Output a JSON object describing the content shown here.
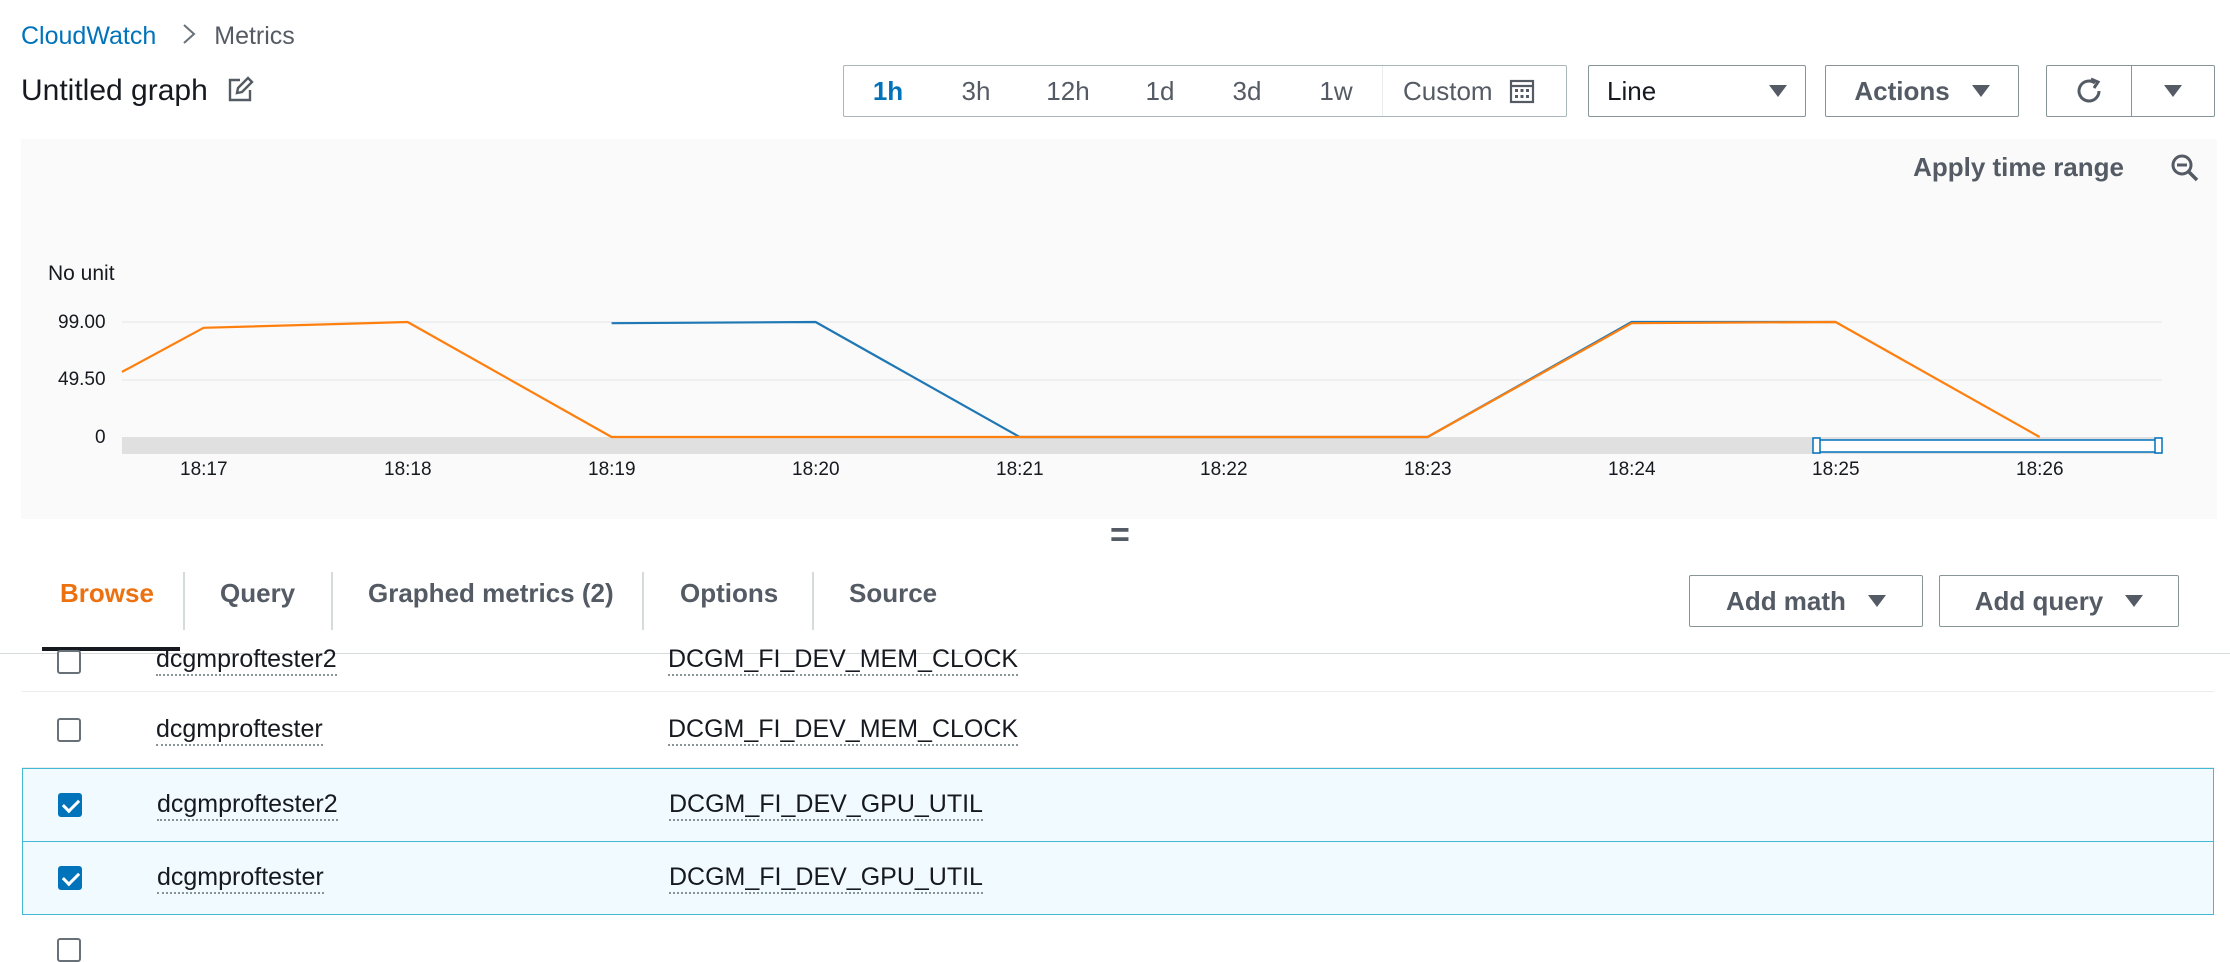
{
  "breadcrumb": {
    "root": "CloudWatch",
    "separator": ">",
    "current": "Metrics"
  },
  "title": "Untitled graph",
  "time_range": {
    "options": [
      "1h",
      "3h",
      "12h",
      "1d",
      "3d",
      "1w"
    ],
    "active": "1h",
    "custom_label": "Custom"
  },
  "toolbar": {
    "chart_type": "Line",
    "actions_label": "Actions",
    "refresh_icon": "refresh-icon",
    "dropdown_icon": "caret-down-icon"
  },
  "graph": {
    "apply_time_range": "Apply time range",
    "zoom_icon": "zoom-out-icon"
  },
  "chart_data": {
    "type": "line",
    "ylabel": "No unit",
    "yticks": [
      "99.00",
      "49.50",
      "0"
    ],
    "ylim": [
      0,
      99
    ],
    "x_minutes": [
      "18:17",
      "18:18",
      "18:19",
      "18:20",
      "18:21",
      "18:22",
      "18:23",
      "18:24",
      "18:25",
      "18:26"
    ],
    "xlim": [
      "18:16:36",
      "18:26:36"
    ],
    "series": [
      {
        "color": "#1f77b4",
        "points": [
          [
            "18:19",
            98
          ],
          [
            "18:20",
            99
          ],
          [
            "18:21",
            0
          ],
          [
            "18:22",
            0
          ],
          [
            "18:23",
            0
          ],
          [
            "18:24",
            99
          ],
          [
            "18:25",
            99
          ]
        ]
      },
      {
        "color": "#ff7f0e",
        "points": [
          [
            "18:16:36",
            56
          ],
          [
            "18:17",
            94
          ],
          [
            "18:18",
            99
          ],
          [
            "18:19",
            0
          ],
          [
            "18:20",
            0
          ],
          [
            "18:21",
            0
          ],
          [
            "18:22",
            0
          ],
          [
            "18:23",
            0
          ],
          [
            "18:24",
            98
          ],
          [
            "18:25",
            99
          ],
          [
            "18:26",
            0
          ]
        ]
      }
    ]
  },
  "resize_handle": "=",
  "tabs": [
    {
      "label": "Browse",
      "active": true
    },
    {
      "label": "Query",
      "active": false
    },
    {
      "label": "Graphed metrics (2)",
      "active": false
    },
    {
      "label": "Options",
      "active": false
    },
    {
      "label": "Source",
      "active": false
    }
  ],
  "tab_buttons": {
    "add_math": "Add math",
    "add_query": "Add query"
  },
  "rows": [
    {
      "name": "dcgmproftester2",
      "metric": "DCGM_FI_DEV_MEM_CLOCK",
      "checked": false
    },
    {
      "name": "dcgmproftester",
      "metric": "DCGM_FI_DEV_MEM_CLOCK",
      "checked": false
    },
    {
      "name": "dcgmproftester2",
      "metric": "DCGM_FI_DEV_GPU_UTIL",
      "checked": true
    },
    {
      "name": "dcgmproftester",
      "metric": "DCGM_FI_DEV_GPU_UTIL",
      "checked": true
    }
  ],
  "colors": {
    "accent_blue": "#0073bb",
    "accent_orange": "#ec7211",
    "selected_row_bg": "#f1faff"
  }
}
